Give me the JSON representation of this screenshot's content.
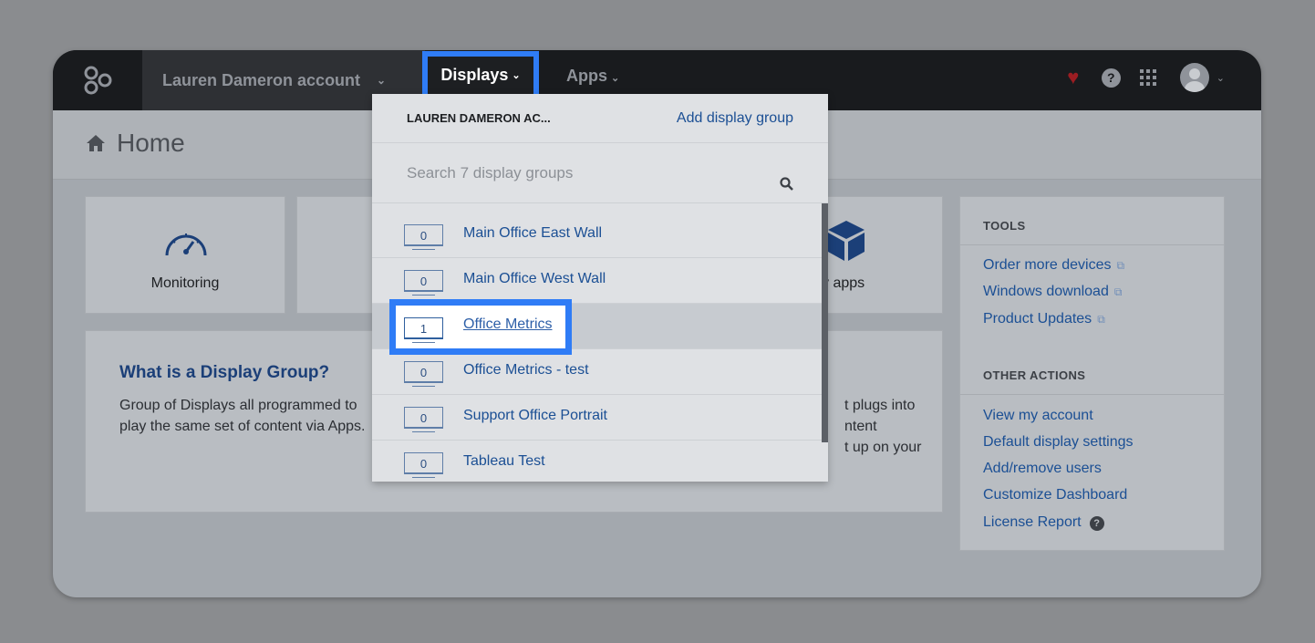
{
  "topbar": {
    "account_name": "Lauren Dameron account",
    "nav_displays": "Displays",
    "nav_apps": "Apps"
  },
  "home": {
    "title": "Home"
  },
  "tiles": [
    {
      "label": "Monitoring"
    },
    {
      "label": "y apps"
    }
  ],
  "info": {
    "title": "What is a Display Group?",
    "text": "Group of Displays all programmed to play the same set of content via Apps.",
    "text_right_lines": [
      "t plugs into",
      "ntent",
      "t up on your"
    ]
  },
  "tools": {
    "heading": "TOOLS",
    "links": [
      "Order more devices",
      "Windows download",
      "Product Updates"
    ],
    "other_heading": "OTHER ACTIONS",
    "other_links": [
      "View my account",
      "Default display settings",
      "Add/remove users",
      "Customize Dashboard",
      "License Report"
    ]
  },
  "dropdown": {
    "account_label": "LAUREN DAMERON AC...",
    "add_group": "Add display group",
    "search_placeholder": "Search 7 display groups",
    "groups": [
      {
        "count": "0",
        "name": "Main Office East Wall"
      },
      {
        "count": "0",
        "name": "Main Office West Wall"
      },
      {
        "count": "1",
        "name": "Office Metrics"
      },
      {
        "count": "0",
        "name": "Office Metrics - test"
      },
      {
        "count": "0",
        "name": "Support Office Portrait"
      },
      {
        "count": "0",
        "name": "Tableau Test"
      }
    ]
  },
  "colors": {
    "accent": "#2f7cf6",
    "link": "#1b4f94",
    "topbar": "#191b1e"
  }
}
